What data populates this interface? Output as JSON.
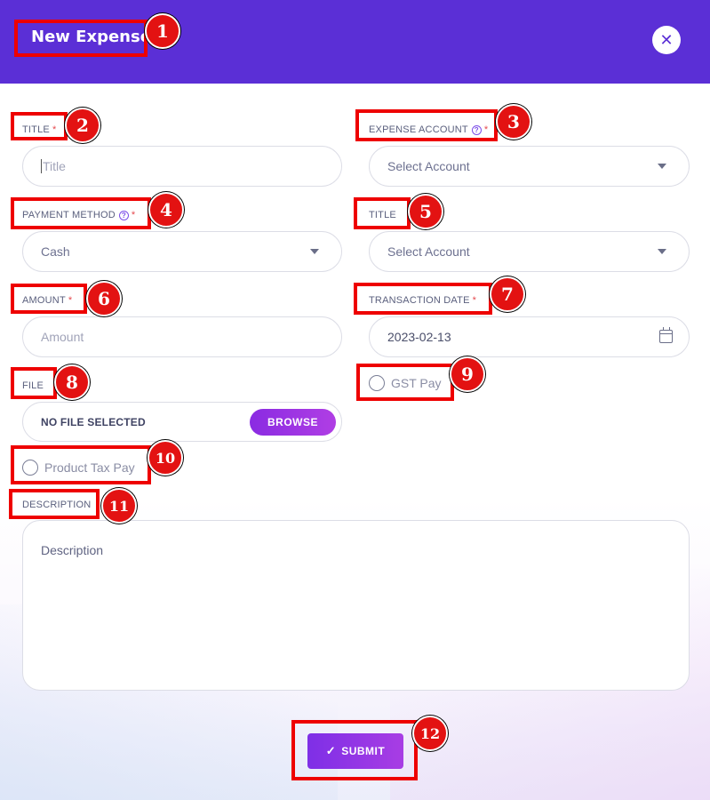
{
  "header": {
    "title": "New Expense",
    "close_icon": "close-icon"
  },
  "fields": {
    "title": {
      "label": "TITLE",
      "required": "*",
      "placeholder": "Title"
    },
    "expense_account": {
      "label": "EXPENSE ACCOUNT",
      "required": "*",
      "value": "Select Account"
    },
    "payment_method": {
      "label": "PAYMENT METHOD",
      "required": "*",
      "value": "Cash"
    },
    "title2": {
      "label": "TITLE",
      "value": "Select Account"
    },
    "amount": {
      "label": "AMOUNT",
      "required": "*",
      "placeholder": "Amount"
    },
    "transaction_date": {
      "label": "TRANSACTION DATE",
      "required": "*",
      "value": "2023-02-13"
    },
    "file": {
      "label": "FILE",
      "status": "NO FILE SELECTED",
      "browse_label": "BROWSE"
    },
    "gst_pay": {
      "label": "GST Pay"
    },
    "product_tax_pay": {
      "label": "Product Tax Pay"
    },
    "description": {
      "label": "DESCRIPTION",
      "placeholder": "Description"
    }
  },
  "submit": {
    "label": "SUBMIT",
    "icon": "check-icon"
  },
  "annotations": [
    "1",
    "2",
    "3",
    "4",
    "5",
    "6",
    "7",
    "8",
    "9",
    "10",
    "11",
    "12"
  ],
  "colors": {
    "header": "#5b2fd6",
    "accent": "#8a2be2",
    "required": "#e5484d",
    "highlight": "#ee0000"
  }
}
